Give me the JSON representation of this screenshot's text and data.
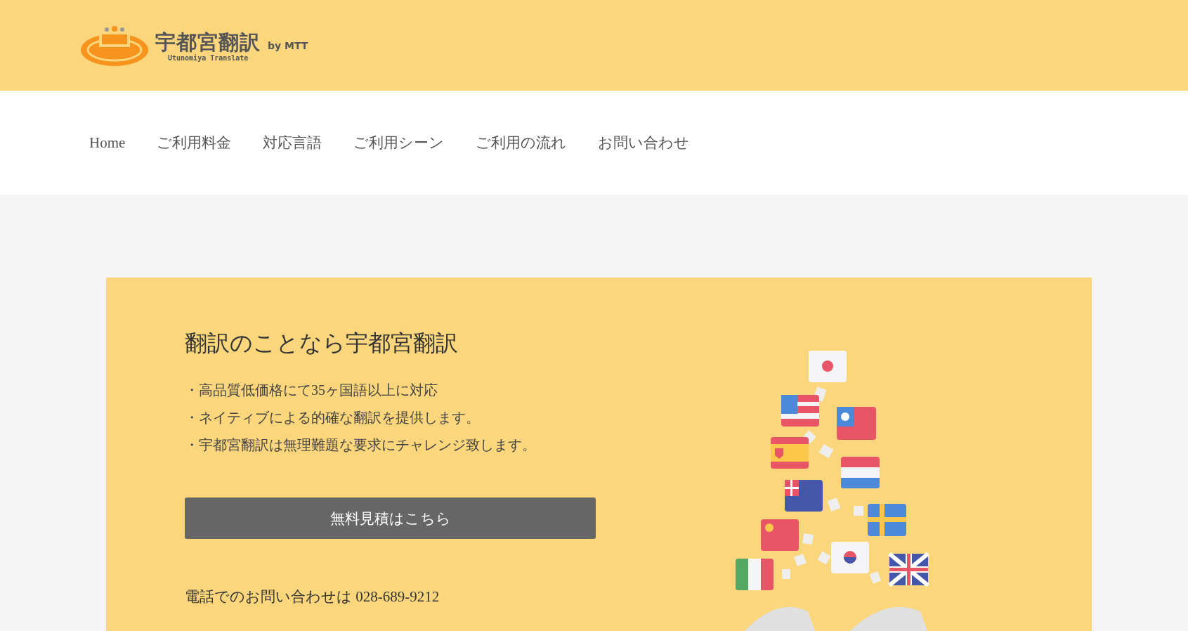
{
  "header": {
    "logo_title": "宇都宮翻訳",
    "logo_by": "by MTT",
    "logo_subtitle": "Utunomiya Translate"
  },
  "nav": {
    "items": [
      {
        "label": "Home"
      },
      {
        "label": "ご利用料金"
      },
      {
        "label": "対応言語"
      },
      {
        "label": "ご利用シーン"
      },
      {
        "label": "ご利用の流れ"
      },
      {
        "label": "お問い合わせ"
      }
    ]
  },
  "hero": {
    "title": "翻訳のことなら宇都宮翻訳",
    "bullets": [
      "・高品質低価格にて35ヶ国語以上に対応",
      "・ネイティブによる的確な翻訳を提供します。",
      "・宇都宮翻訳は無理難題な要求にチャレンジ致します。"
    ],
    "button": "無料見積はこちら",
    "phone": "電話でのお問い合わせは 028-689-9212"
  }
}
